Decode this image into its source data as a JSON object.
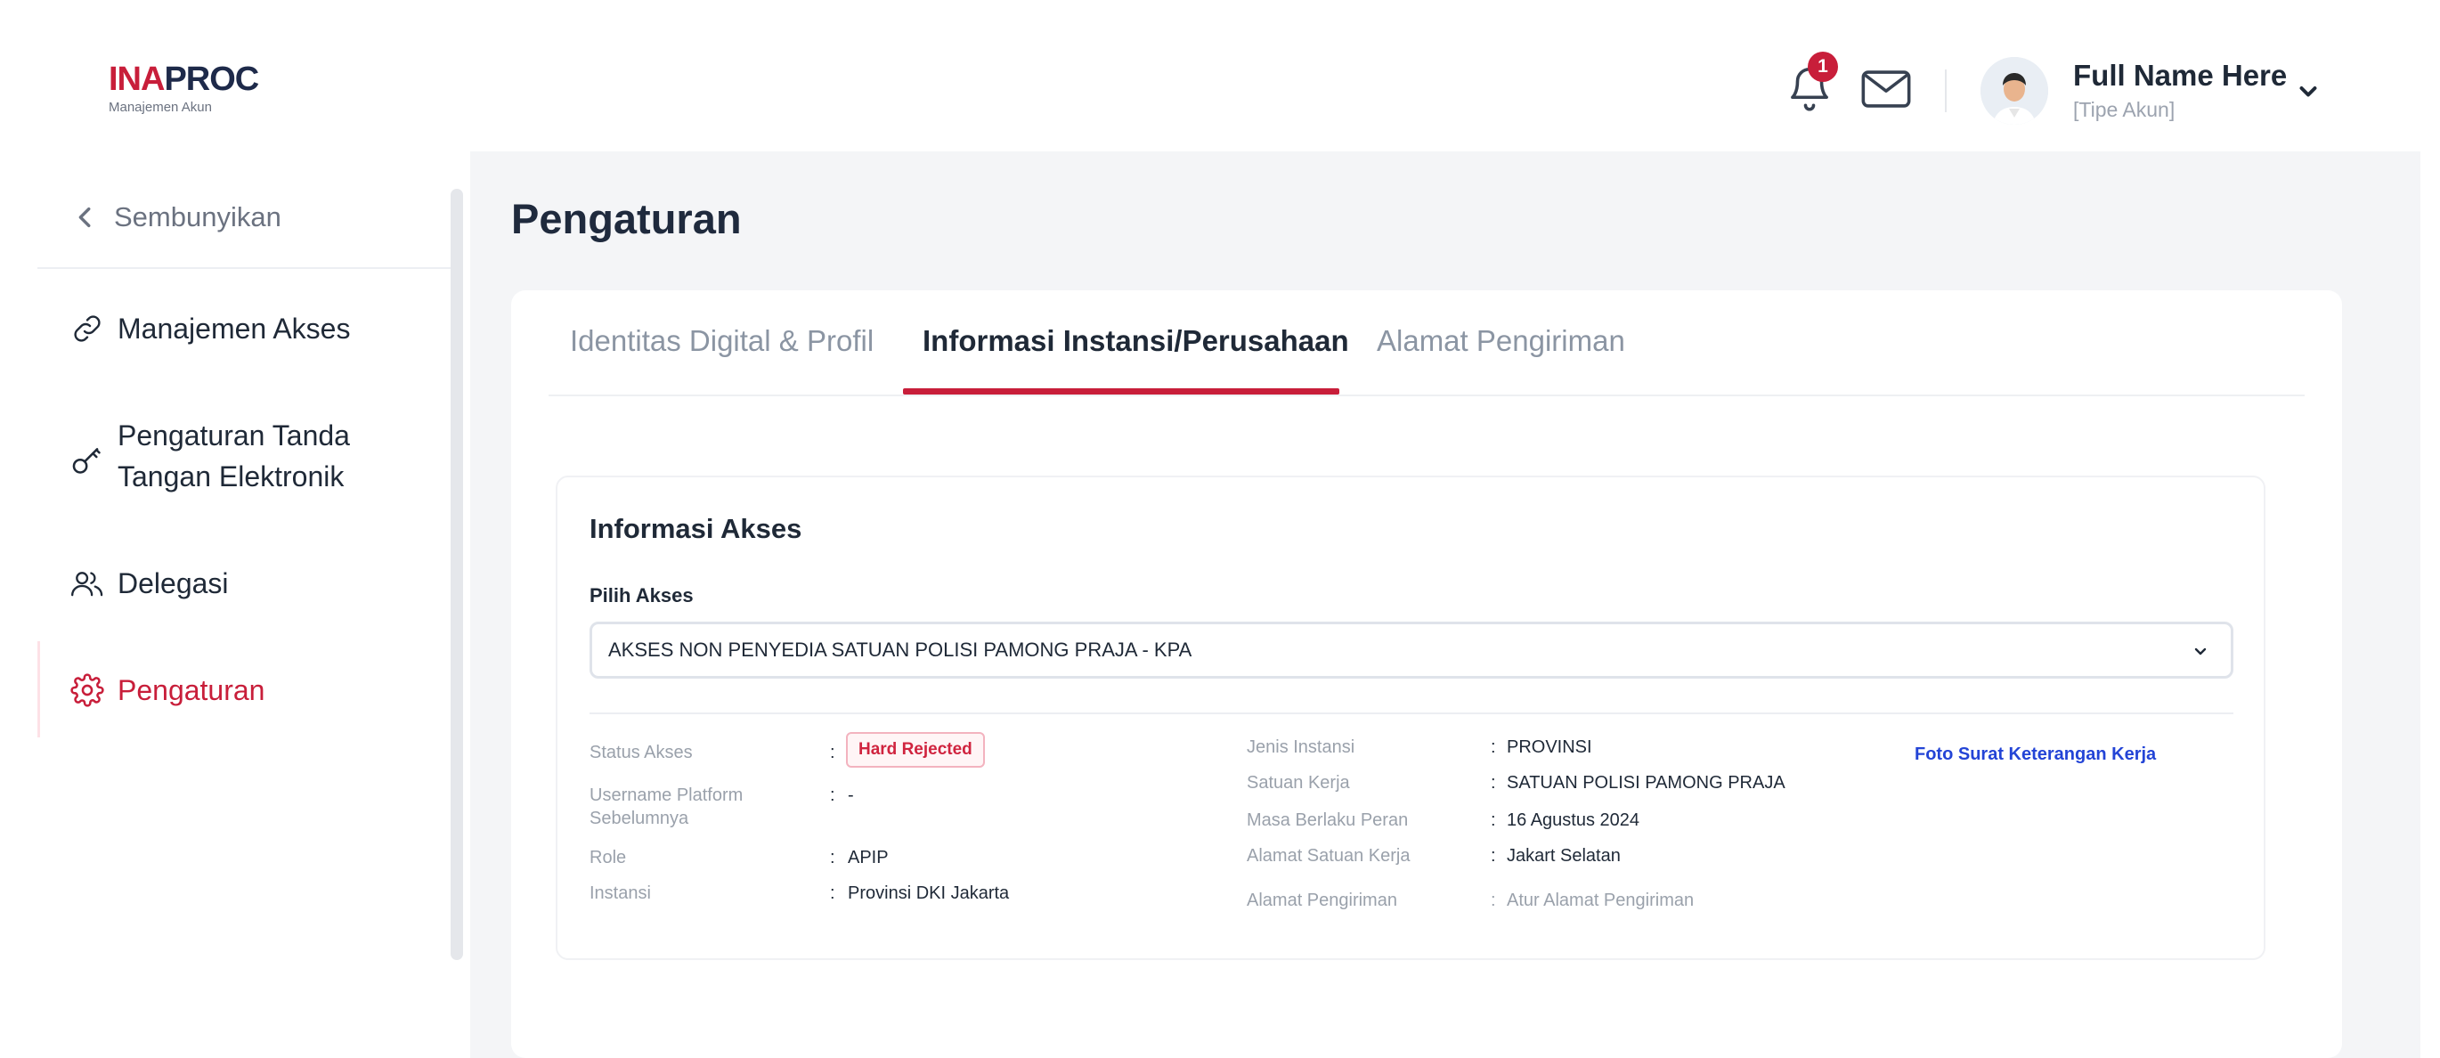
{
  "header": {
    "logo_red": "INA",
    "logo_navy": "PROC",
    "logo_subtitle": "Manajemen Akun",
    "notification_count": "1",
    "user_name": "Full Name Here",
    "user_type": "[Tipe Akun]"
  },
  "sidebar": {
    "hide_label": "Sembunyikan",
    "items": [
      {
        "label": "Manajemen Akses",
        "icon": "link-icon"
      },
      {
        "label": "Pengaturan Tanda Tangan Elektronik",
        "line1": "Pengaturan Tanda",
        "line2": "Tangan Elektronik",
        "icon": "key-icon"
      },
      {
        "label": "Delegasi",
        "icon": "users-icon"
      },
      {
        "label": "Pengaturan",
        "icon": "gear-icon",
        "active": true
      }
    ]
  },
  "main": {
    "page_title": "Pengaturan",
    "tabs": [
      {
        "label": "Identitas Digital & Profil"
      },
      {
        "label": "Informasi Instansi/Perusahaan",
        "active": true
      },
      {
        "label": "Alamat Pengiriman"
      }
    ],
    "section": {
      "title": "Informasi Akses",
      "select_label": "Pilih Akses",
      "select_value": "AKSES NON PENYEDIA SATUAN POLISI PAMONG PRAJA - KPA",
      "left_fields": [
        {
          "label": "Status Akses",
          "value": "Hard Rejected"
        },
        {
          "label": "Username Platform Sebelumnya",
          "label1": "Username Platform",
          "label2": "Sebelumnya",
          "value": "-"
        },
        {
          "label": "Role",
          "value": "APIP"
        },
        {
          "label": "Instansi",
          "value": "Provinsi DKI Jakarta"
        }
      ],
      "right_fields": [
        {
          "label": "Jenis Instansi",
          "value": "PROVINSI"
        },
        {
          "label": "Satuan Kerja",
          "value": "SATUAN POLISI PAMONG PRAJA"
        },
        {
          "label": "Masa Berlaku Peran",
          "value": "16 Agustus 2024"
        },
        {
          "label": "Alamat Satuan Kerja",
          "value": "Jakart Selatan"
        },
        {
          "label": "Alamat Pengiriman",
          "value": "Atur Alamat Pengiriman"
        }
      ],
      "separator": ":",
      "document_link": "Foto Surat Keterangan Kerja"
    }
  },
  "colors": {
    "brand_red": "#c81e3a",
    "brand_navy": "#1e2a4a",
    "link_blue": "#2344d6",
    "main_bg": "#f4f5f7"
  }
}
